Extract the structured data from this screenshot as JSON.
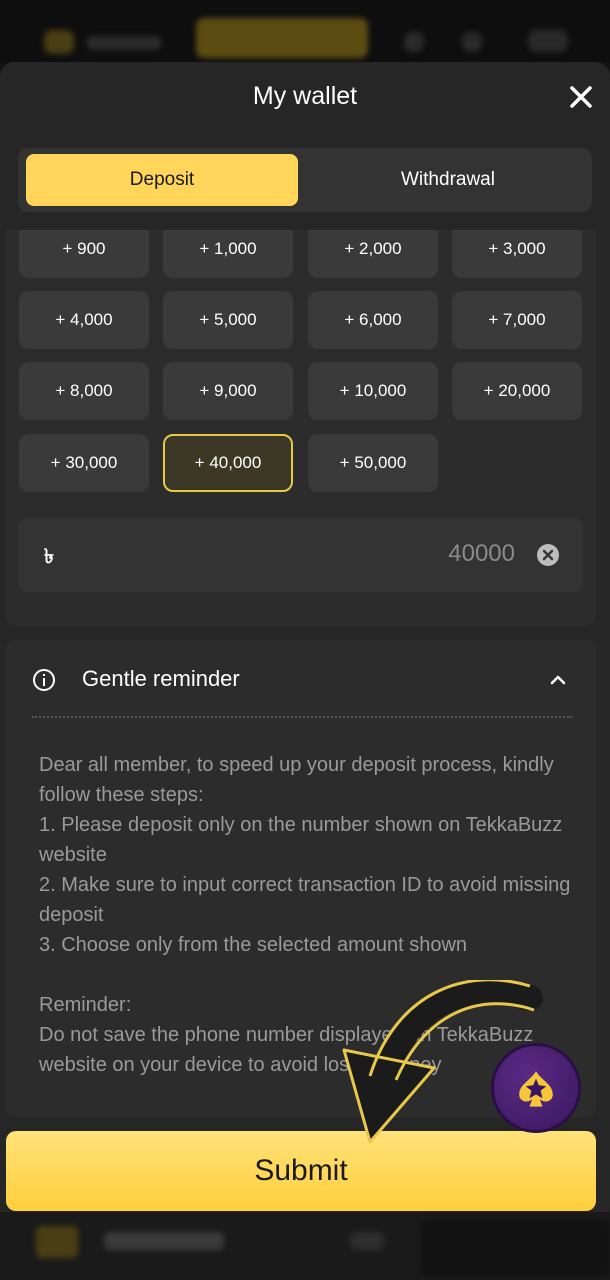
{
  "sheet": {
    "title": "My wallet"
  },
  "tabs": [
    {
      "label": "Deposit",
      "active": true
    },
    {
      "label": "Withdrawal",
      "active": false
    }
  ],
  "amounts": [
    "+ 900",
    "+ 1,000",
    "+ 2,000",
    "+ 3,000",
    "+ 4,000",
    "+ 5,000",
    "+ 6,000",
    "+ 7,000",
    "+ 8,000",
    "+ 9,000",
    "+ 10,000",
    "+ 20,000",
    "+ 30,000",
    "+ 40,000",
    "+ 50,000"
  ],
  "selected_amount": "+ 40,000",
  "amount_input": {
    "currency_symbol": "৳",
    "value": "40000"
  },
  "reminder": {
    "title": "Gentle reminder",
    "lines": [
      "Dear all member, to speed up your deposit process, kindly follow these steps:",
      "1. Please deposit only on the number shown on TekkaBuzz website",
      "2. Make sure to input correct transaction ID to avoid missing deposit",
      "3. Choose only from the selected amount shown"
    ],
    "reminder_label": "Reminder:",
    "reminder_body": "Do not save the phone number displayed on TekkaBuzz website on your device to avoid losing money"
  },
  "submit_label": "Submit",
  "colors": {
    "accent": "#ffd65a",
    "sheet": "#262626",
    "support_button": "#4a1f72"
  }
}
